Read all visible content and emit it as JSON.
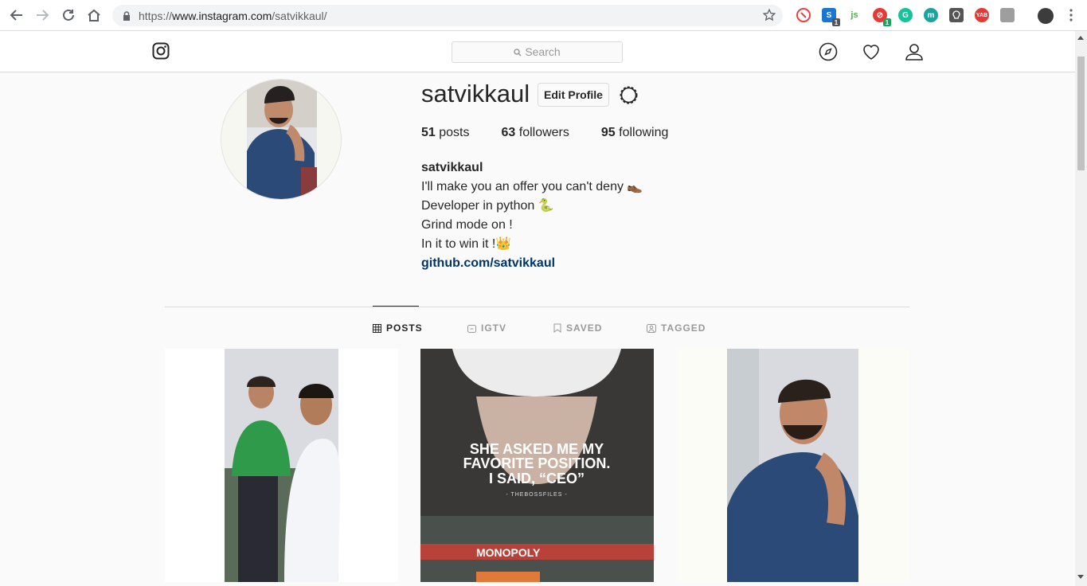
{
  "browser": {
    "url_prefix": "https://",
    "url_host": "www.instagram.com",
    "url_path": "/satvikkaul/",
    "extensions": [
      {
        "icon": "ghostery-icon",
        "color": "#e8413e"
      },
      {
        "icon": "s-extension-icon",
        "color": "#1976d2",
        "badge": "1"
      },
      {
        "icon": "js-extension-icon",
        "color": "#4caf50",
        "label": "js"
      },
      {
        "icon": "block-extension-icon",
        "color": "#e53935",
        "badge": "1"
      },
      {
        "icon": "grammarly-icon",
        "color": "#15c39a",
        "label": "G"
      },
      {
        "icon": "m-extension-icon",
        "color": "#1ba39c",
        "label": "m"
      },
      {
        "icon": "keeper-icon",
        "color": "#555555"
      },
      {
        "icon": "yab-extension-icon",
        "color": "#e53935",
        "label": "YAB"
      },
      {
        "icon": "gray-extension-icon",
        "color": "#9e9e9e"
      }
    ]
  },
  "header": {
    "search_placeholder": "Search"
  },
  "profile": {
    "username": "satvikkaul",
    "edit_profile_label": "Edit Profile",
    "stats": {
      "posts_count": "51",
      "posts_label": "posts",
      "followers_count": "63",
      "followers_label": "followers",
      "following_count": "95",
      "following_label": "following"
    },
    "bio": {
      "name": "satvikkaul",
      "line1": "I'll make you an offer you can't deny 👞",
      "line2": "Developer in python 🐍",
      "line3": "Grind mode on !",
      "line4": "In it to win it !👑",
      "link": "github.com/satvikkaul"
    }
  },
  "tabs": [
    {
      "label": "POSTS",
      "icon": "grid-icon",
      "active": true
    },
    {
      "label": "IGTV",
      "icon": "igtv-icon",
      "active": false
    },
    {
      "label": "SAVED",
      "icon": "bookmark-icon",
      "active": false
    },
    {
      "label": "TAGGED",
      "icon": "tagged-icon",
      "active": false
    }
  ],
  "posts": [
    {
      "alt": "two men selfie"
    },
    {
      "caption_line1": "SHE ASKED ME MY",
      "caption_line2": "FAVORITE POSITION.",
      "caption_line3": "I SAID, “CEO”",
      "caption_credit": "- THEBOSSFILES -",
      "board_text": "MONOPOLY"
    },
    {
      "alt": "man thinking selfie"
    }
  ]
}
